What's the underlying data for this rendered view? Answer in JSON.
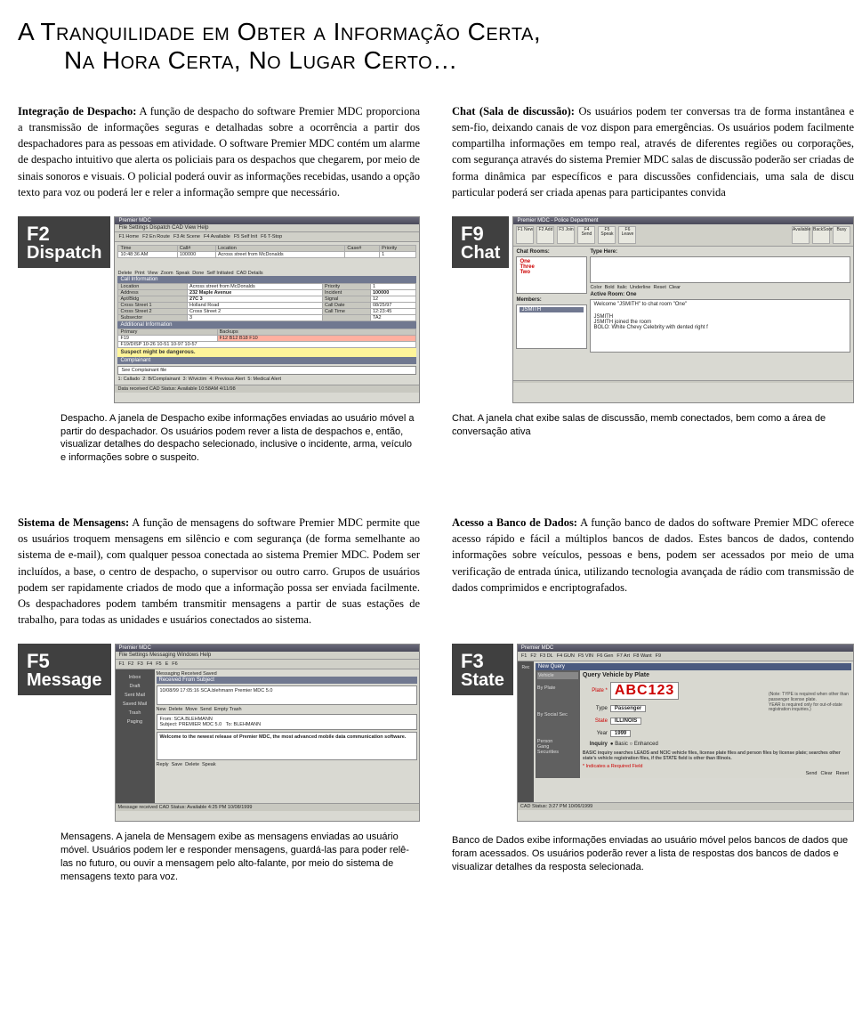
{
  "title": {
    "line1": "A Tranquilidade em Obter a Informação Certa,",
    "line2": "Na Hora Certa, No Lugar Certo…"
  },
  "section1": {
    "left": {
      "lead": "Integração de Despacho:",
      "body": " A função de despacho do software Premier MDC proporciona a transmissão de informações seguras e detalhadas sobre a ocorrência a partir dos despachadores para as pessoas em atividade. O software Premier MDC contém um alarme de despacho intuitivo que alerta os policiais para os despachos que chegarem, por meio de sinais sonoros e visuais. O policial poderá ouvir as informações recebidas, usando a opção texto para voz ou poderá ler e reler a informação sempre que necessário."
    },
    "right": {
      "lead": "Chat (Sala de discussão):",
      "body": " Os usuários podem ter conversas tra de forma instantânea e sem-fio, deixando canais de voz dispon para emergências. Os usuários podem facilmente compartilha informações em tempo real, através de diferentes regiões ou corporações, com segurança através do sistema Premier MDC salas de discussão poderão ser criadas de forma dinâmica par específicos e para discussões confidenciais, uma sala de discu particular poderá ser criada apenas para participantes convida"
    }
  },
  "fig1": {
    "leftKey": "F2",
    "leftKeyLabel": "Dispatch",
    "rightKey": "F9",
    "rightKeyLabel": "Chat",
    "dispatch": {
      "title": "Premier MDC",
      "menu": "File  Settings  Dispatch  CAD View  Help",
      "toolbar": [
        "F1 Home",
        "F2 En Route",
        "F3 At Scene",
        "F4 Available",
        "F5 Self Init",
        "F6 T-Stop"
      ],
      "rowTime": "10:48:36 AM",
      "rowCall": "100000",
      "rowLoc": "Across street from McDonalds",
      "rowCase": "",
      "rowPri": "1",
      "btns": [
        "Delete",
        "Print",
        "View",
        "Zoom",
        "Speak",
        "Done",
        "Self Initiated",
        "CAD Details"
      ],
      "band1": "Call Information",
      "loc": "Across street from McDonalds",
      "addr": "232 Maple Avenue",
      "apt": "27C 3",
      "cross1": "Holland Road",
      "cross2": "Cross Street 2",
      "sub": "3",
      "pri": "1",
      "inc": "100000",
      "sig": "12",
      "cdate": "08/25/97",
      "ctime": "12:23:45",
      "taz": "TA2",
      "band2": "Additional Information",
      "primary": "F19",
      "backhdr": "Backups",
      "backups": "F12  B12  B18  F10",
      "disp": "F19/DISP   10-26 10-51 10-97 10-57",
      "alert": "Suspect might be dangerous.",
      "band3": "Complainant",
      "comp": "See Complainant file",
      "foot": [
        "1: Callado",
        "2: B/Complainant",
        "3: W/victim",
        "4: Previous Alert",
        "5: Medical Alert"
      ],
      "status": "Data received    CAD Status: Available    10:58AM   4/11/98"
    },
    "chat": {
      "title": "Premier MDC - Police Department",
      "toolbar": [
        "F1 New",
        "F2 Add",
        "F3 Join",
        "F4 Send",
        "F5 Speak",
        "F6 Leave",
        "",
        "Available",
        "BackSoon",
        "Busy"
      ],
      "roomsHdr": "Chat Rooms:",
      "rooms": [
        "One",
        "Three",
        "Two"
      ],
      "membersHdr": "Members:",
      "member": "JSMITH",
      "fmt": [
        "Color",
        "Bold",
        "Italic",
        "Underline",
        "Reset",
        "Clear"
      ],
      "activeHdr": "Active Room: One",
      "line1": "Welcome \"JSMITH\" to chat room \"One\"",
      "line2": "JSMITH joined the room",
      "line3": "BOLO: White Chevy Celebrity with dented right f",
      "typeHere": "Type Here:"
    },
    "captionLeft": "Despacho. A janela de Despacho exibe informações enviadas ao usuário móvel a partir do despachador. Os usuários podem rever a lista de despachos e, então, visualizar detalhes do despacho selecionado, inclusive o incidente, arma, veículo e informações sobre o suspeito.",
    "captionRight": "Chat. A janela chat exibe salas de discussão, memb conectados, bem como a área de conversação ativa"
  },
  "section2": {
    "left": {
      "lead": "Sistema de Mensagens:",
      "body": " A função de mensagens do software Premier MDC permite que os usuários troquem mensagens em silêncio e com segurança (de forma semelhante ao sistema de e-mail), com qualquer pessoa conectada ao sistema Premier MDC. Podem ser incluídos, a base, o centro de despacho, o supervisor ou outro carro. Grupos de usuários podem ser rapidamente criados de modo que a informação possa ser enviada facilmente. Os despachadores podem também transmitir mensagens a partir de suas estações de trabalho, para todas as unidades e usuários conectados ao sistema."
    },
    "right": {
      "lead": "Acesso a Banco de Dados:",
      "body": " A função banco de dados do software Premier MDC oferece acesso rápido e fácil a múltiplos bancos de dados. Estes bancos de dados, contendo informações sobre veículos, pessoas e bens, podem ser acessados por meio de uma verificação de entrada única, utilizando tecnologia avançada de rádio com transmissão de dados comprimidos e encriptografados."
    }
  },
  "fig2": {
    "leftKey": "F5",
    "leftKeyLabel": "Message",
    "rightKey": "F3",
    "rightKeyLabel": "State",
    "msg": {
      "title": "Premier MDC",
      "menu": "File  Settings  Messaging  Windows  Help",
      "toolbar": [
        "F1",
        "F2",
        "F3",
        "F4",
        "F5",
        "E",
        "F6"
      ],
      "tabs": "Messaging    Received    Saved",
      "cols": "Received          From           Subject",
      "row": "10/08/99 17:05:16   SCA.blehmann   Premier MDC 5.0",
      "sb": [
        "Inbox",
        "Draft",
        "Sent Mail",
        "Saved Mail",
        "Trash",
        "Paging"
      ],
      "btns": [
        "New",
        "Delete",
        "Move",
        "Send",
        "Empty Trash"
      ],
      "from": "From:  SCA.BLEHMANN",
      "subj": "Subject:  PREMIER MDC 5.0",
      "to": "To:  BLEHMANN",
      "body": "Welcome to the newest release of Premier MDC, the most advanced mobile data communication software.",
      "foot": [
        "Reply",
        "Save",
        "Delete",
        "Speak"
      ],
      "status": "Message received      CAD Status: Available      4:25 PM   10/08/1999"
    },
    "state": {
      "title": "Premier MDC",
      "toolbar": [
        "F1",
        "F2",
        "F3 DL",
        "F4 GUN",
        "F5 VIN",
        "F6 Gen",
        "F7 Art",
        "F8 Want",
        "F9"
      ],
      "tabRec": "Rec",
      "band": "New Query",
      "qhdr": "Query Vehicle by Plate",
      "vehicle": "Vehicle",
      "byplate": "By Plate",
      "plate": "ABC123",
      "type": "Type",
      "typeval": "Passenger",
      "state": "State",
      "stateval": "ILLINOIS",
      "bysoc": "By Social Sec",
      "year": "Year",
      "yearval": "1999",
      "note1": "(Note: TYPE is required when other than passenger license plate.",
      "note2": "YEAR is required only for out-of-state registration inquiries.)",
      "inq": "Inquiry",
      "inqopt": "● Basic  ○ Enhanced",
      "desc": "BASIC inquiry searches LEADS and NCIC vehicle files, license plate files and person files by license plate; searches other state's vehicle registration files, if the STATE field is other than Illinois.",
      "req": "* Indicates a Required Field",
      "btns": [
        "Send",
        "Clear",
        "Reset"
      ],
      "itemsLeft": [
        "Person",
        "Gang",
        "Securities"
      ],
      "status": "CAD Status:        3:27 PM   10/06/1999"
    },
    "captionLeft": "Mensagens. A janela de Mensagem exibe as mensagens enviadas ao usuário móvel. Usuários podem ler e responder mensagens, guardá-las para poder relê-las no futuro, ou ouvir a mensagem pelo alto-falante, por meio do sistema de mensagens texto para voz.",
    "captionRight": "Banco de Dados exibe informações enviadas ao usuário móvel pelos bancos de dados que foram acessados. Os usuários poderão rever a lista de respostas dos bancos de dados e visualizar detalhes da resposta selecionada."
  }
}
